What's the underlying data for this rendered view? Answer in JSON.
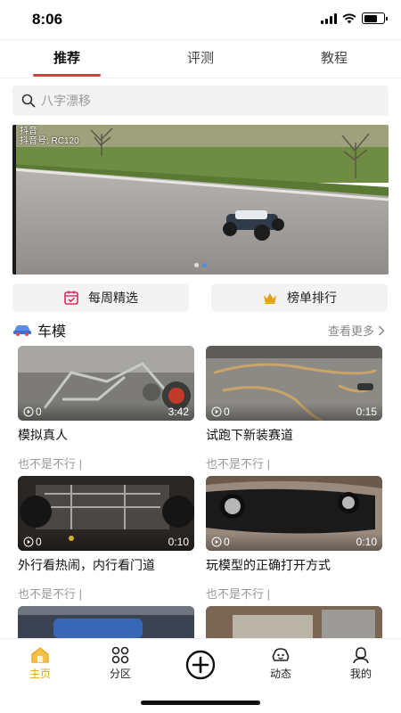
{
  "status_bar": {
    "time": "8:06"
  },
  "tabs": [
    {
      "label": "推荐",
      "active": true
    },
    {
      "label": "评测",
      "active": false
    },
    {
      "label": "教程",
      "active": false
    }
  ],
  "search": {
    "placeholder": "八字漂移"
  },
  "banner": {
    "watermark_line1": "抖音",
    "watermark_line2": "抖音号: RC120",
    "dots": 2,
    "active_dot": 1
  },
  "quick_actions": {
    "weekly": {
      "label": "每周精选",
      "icon": "calendar-check-icon"
    },
    "ranking": {
      "label": "榜单排行",
      "icon": "crown-icon"
    }
  },
  "section": {
    "icon": "car-icon",
    "title": "车模",
    "more_label": "查看更多"
  },
  "videos": [
    {
      "title": "模拟真人",
      "author": "也不是不行",
      "views": "0",
      "duration": "3:42"
    },
    {
      "title": "试跑下新装赛道",
      "author": "也不是不行",
      "views": "0",
      "duration": "0:15"
    },
    {
      "title": "外行看热闹，内行看门道",
      "author": "也不是不行",
      "views": "0",
      "duration": "0:10"
    },
    {
      "title": "玩模型的正确打开方式",
      "author": "也不是不行",
      "views": "0",
      "duration": "0:10"
    }
  ],
  "bottom_nav": [
    {
      "label": "主页",
      "icon": "home-icon",
      "active": true
    },
    {
      "label": "分区",
      "icon": "category-icon",
      "active": false
    },
    {
      "label": "",
      "icon": "add-circle-icon",
      "active": false
    },
    {
      "label": "动态",
      "icon": "feed-icon",
      "active": false
    },
    {
      "label": "我的",
      "icon": "profile-icon",
      "active": false
    }
  ],
  "colors": {
    "accent_red": "#e23a3a",
    "nav_active": "#e8a31a"
  }
}
